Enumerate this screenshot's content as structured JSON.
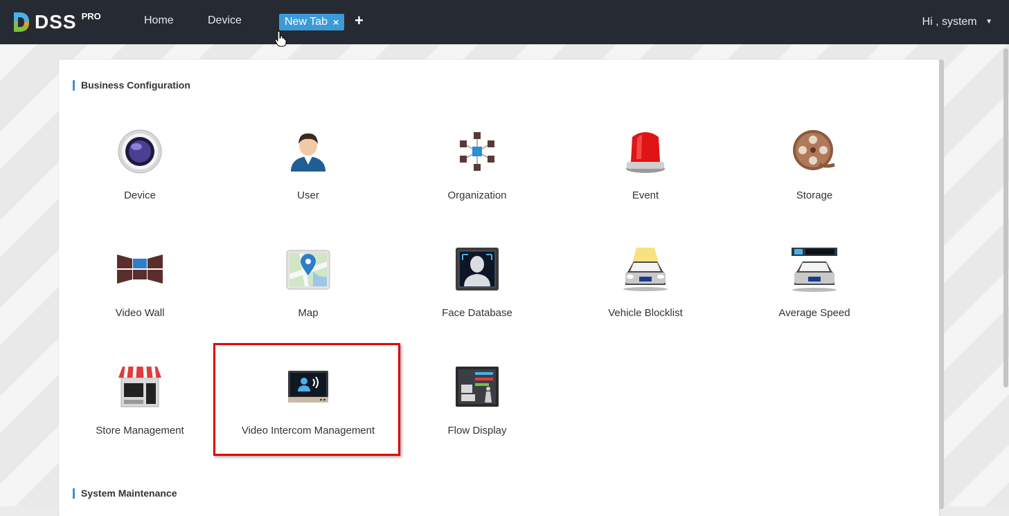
{
  "header": {
    "logo_text": "DSS",
    "logo_badge": "PRO",
    "nav": [
      {
        "label": "Home"
      },
      {
        "label": "Device"
      }
    ],
    "active_tab": {
      "label": "New Tab",
      "close_glyph": "×"
    },
    "add_tab_glyph": "+",
    "user_greeting": "Hi , system",
    "user_caret": "▼"
  },
  "sections": [
    {
      "title": "Business Configuration",
      "tiles": [
        {
          "label": "Device",
          "icon": "device-lens-icon"
        },
        {
          "label": "User",
          "icon": "user-icon"
        },
        {
          "label": "Organization",
          "icon": "organization-cubes-icon"
        },
        {
          "label": "Event",
          "icon": "alarm-beacon-icon"
        },
        {
          "label": "Storage",
          "icon": "film-reel-icon"
        },
        {
          "label": "Video Wall",
          "icon": "video-wall-icon"
        },
        {
          "label": "Map",
          "icon": "map-pin-icon"
        },
        {
          "label": "Face Database",
          "icon": "face-database-icon"
        },
        {
          "label": "Vehicle Blocklist",
          "icon": "vehicle-blocklist-icon"
        },
        {
          "label": "Average Speed",
          "icon": "average-speed-icon"
        },
        {
          "label": "Store Management",
          "icon": "store-icon"
        },
        {
          "label": "Video Intercom Management",
          "icon": "video-intercom-icon"
        },
        {
          "label": "Flow Display",
          "icon": "flow-display-icon"
        }
      ]
    },
    {
      "title": "System Maintenance",
      "tiles": []
    }
  ],
  "colors": {
    "topbar": "#262b33",
    "accent": "#3d9ad8",
    "highlight": "#e00000"
  }
}
